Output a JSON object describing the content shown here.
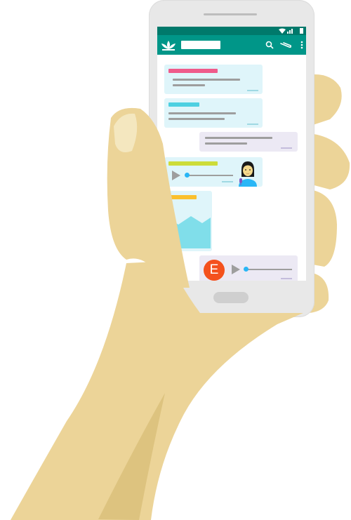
{
  "colors": {
    "skin": "#ecd498",
    "skin_shadow": "#ddc37f",
    "phone_body": "#e8e8e8",
    "app_bar": "#009688",
    "status_bar": "#00796b",
    "incoming_bubble": "#dff5fa",
    "outgoing_bubble": "#ece9f4",
    "accent_pink": "#ef5b8b",
    "accent_cyan": "#4dd0e1",
    "accent_lime": "#cddc39",
    "accent_yellow": "#fbc02d",
    "avatar_orange": "#f4511e",
    "audio_dot": "#29b6f6"
  },
  "icons": {
    "app_logo": "lotus-icon",
    "search": "search-icon",
    "attach": "paperclip-icon",
    "menu": "more-vertical-icon",
    "wifi": "wifi-icon",
    "signal": "signal-icon",
    "battery": "battery-icon",
    "play": "play-icon",
    "mic": "mic-icon"
  },
  "messages": {
    "avatar_letter": "E"
  }
}
